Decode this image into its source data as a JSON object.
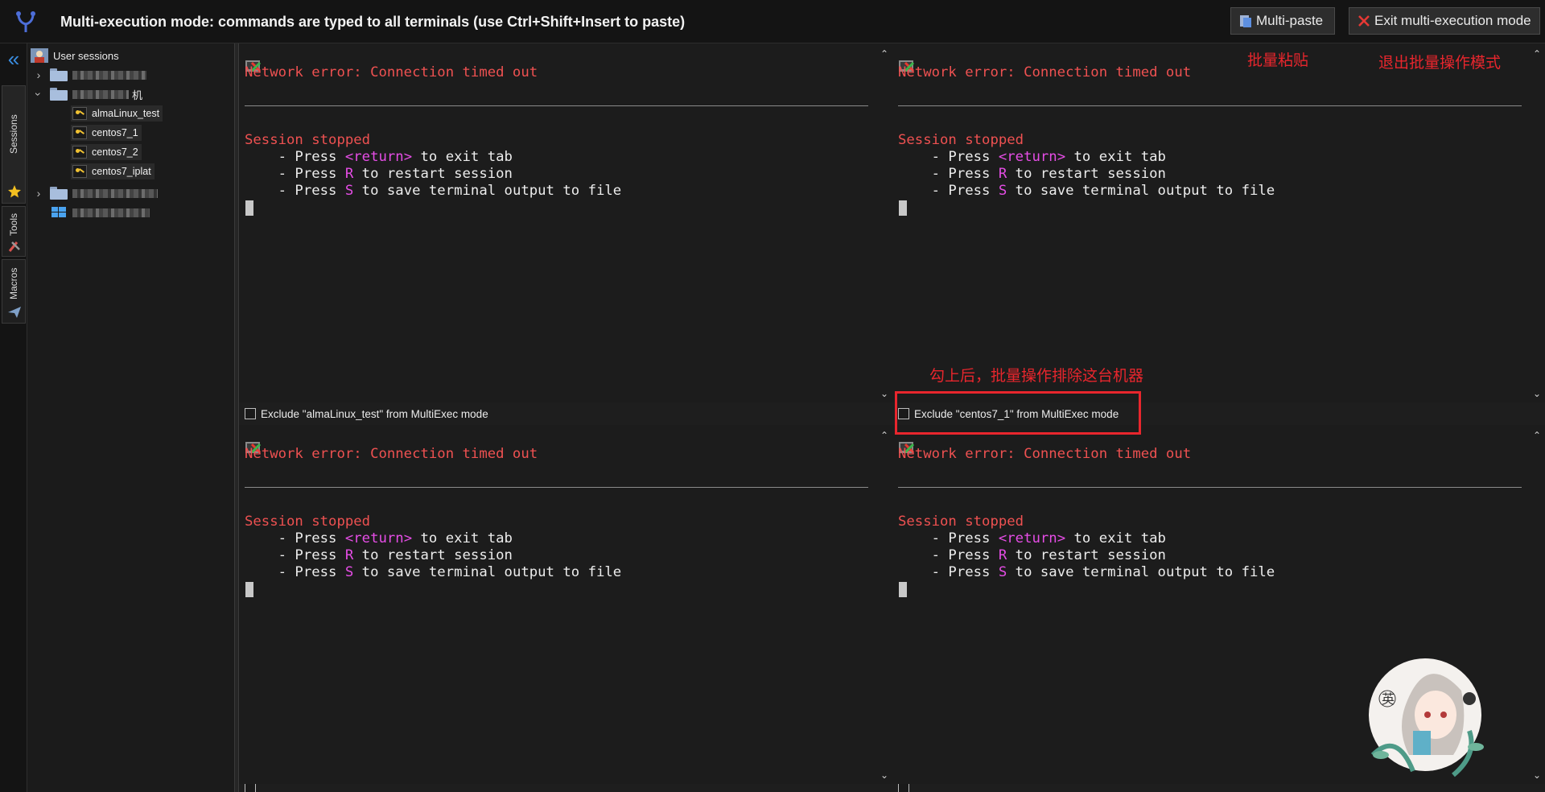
{
  "toolbar": {
    "title": "Multi-execution mode: commands are typed to all terminals (use Ctrl+Shift+Insert to paste)",
    "multipaste_label": "Multi-paste",
    "exit_label": "Exit multi-execution mode"
  },
  "side_tabs": {
    "sessions": "Sessions",
    "tools": "Tools",
    "macros": "Macros"
  },
  "tree": {
    "root_label": "User sessions",
    "folder2_suffix": "机",
    "sessions": [
      "almaLinux_test",
      "centos7_1",
      "centos7_2",
      "centos7_iplat"
    ]
  },
  "terminal": {
    "error": "Network error: Connection timed out",
    "stopped": "Session stopped",
    "l1_a": "    - Press ",
    "l1_key": "<return>",
    "l1_b": " to exit tab",
    "l2_a": "    - Press ",
    "l2_key": "R",
    "l2_b": " to restart session",
    "l3_a": "    - Press ",
    "l3_key": "S",
    "l3_b": " to save terminal output to file"
  },
  "panes": [
    {
      "exclude_label": "Exclude \"almaLinux_test\" from MultiExec mode"
    },
    {
      "exclude_label": "Exclude \"centos7_1\" from MultiExec mode"
    },
    {
      "exclude_label": ""
    },
    {
      "exclude_label": ""
    }
  ],
  "annotations": {
    "multipaste": "批量粘贴",
    "exit": "退出批量操作模式",
    "exclude": "勾上后，批量操作排除这台机器"
  },
  "colors": {
    "error_red": "#ee5151",
    "key_magenta": "#e64de6",
    "annotation_red": "#e8262d",
    "accent_blue": "#3a8de0"
  }
}
